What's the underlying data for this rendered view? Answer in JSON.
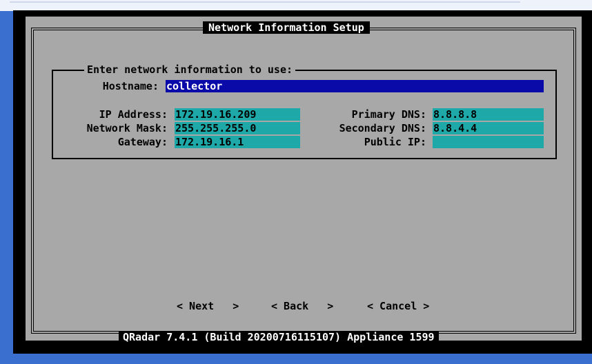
{
  "dialog": {
    "title": "Network Information Setup",
    "group_label": "Enter network information to use:",
    "hostname": {
      "label": "Hostname:",
      "value": "collector"
    },
    "left_fields": [
      {
        "label": "IP Address:",
        "value": "172.19.16.209"
      },
      {
        "label": "Network Mask:",
        "value": "255.255.255.0"
      },
      {
        "label": "Gateway:",
        "value": "172.19.16.1"
      }
    ],
    "right_fields": [
      {
        "label": "Primary DNS:",
        "value": "8.8.8.8"
      },
      {
        "label": "Secondary DNS:",
        "value": "8.8.4.4"
      },
      {
        "label": "Public IP:",
        "value": ""
      }
    ],
    "buttons": {
      "next": "< Next   >",
      "back": "< Back   >",
      "cancel": "< Cancel >"
    },
    "footer": "QRadar 7.4.1 (Build 20200716115107) Appliance 1599"
  },
  "colors": {
    "dialog_bg": "#a8a8a8",
    "field_bg": "#1fa8a8",
    "active_field_bg": "#0a0aa8",
    "screen_bg": "#000000"
  }
}
